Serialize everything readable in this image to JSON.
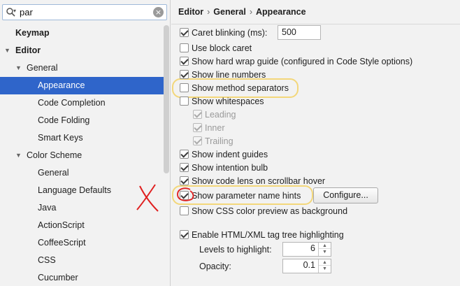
{
  "search": {
    "value": "par"
  },
  "tree": {
    "items": [
      {
        "label": "Keymap"
      },
      {
        "label": "Editor"
      },
      {
        "label": "General"
      },
      {
        "label": "Appearance"
      },
      {
        "label": "Code Completion"
      },
      {
        "label": "Code Folding"
      },
      {
        "label": "Smart Keys"
      },
      {
        "label": "Color Scheme"
      },
      {
        "label": "General"
      },
      {
        "label": "Language Defaults"
      },
      {
        "label": "Java"
      },
      {
        "label": "ActionScript"
      },
      {
        "label": "CoffeeScript"
      },
      {
        "label": "CSS"
      },
      {
        "label": "Cucumber"
      }
    ]
  },
  "breadcrumb": {
    "parts": [
      "Editor",
      "General",
      "Appearance"
    ]
  },
  "options": {
    "caret_blinking": {
      "label": "Caret blinking (ms):",
      "checked": true,
      "value": "500"
    },
    "block_caret": {
      "label": "Use block caret",
      "checked": false
    },
    "hard_wrap": {
      "label": "Show hard wrap guide (configured in Code Style options)",
      "checked": true
    },
    "line_numbers": {
      "label": "Show line numbers",
      "checked": true
    },
    "method_separators": {
      "label": "Show method separators",
      "checked": false
    },
    "whitespaces": {
      "label": "Show whitespaces",
      "checked": false
    },
    "leading": {
      "label": "Leading",
      "checked": true
    },
    "inner": {
      "label": "Inner",
      "checked": true
    },
    "trailing": {
      "label": "Trailing",
      "checked": true
    },
    "indent_guides": {
      "label": "Show indent guides",
      "checked": true
    },
    "intention_bulb": {
      "label": "Show intention bulb",
      "checked": true
    },
    "code_lens": {
      "label": "Show code lens on scrollbar hover",
      "checked": true
    },
    "param_hints": {
      "label": "Show parameter name hints",
      "checked": true
    },
    "configure_button": "Configure...",
    "css_color_preview": {
      "label": "Show CSS color preview as background",
      "checked": false
    },
    "tag_tree": {
      "label": "Enable HTML/XML tag tree highlighting",
      "checked": true
    },
    "levels": {
      "label": "Levels to highlight:",
      "value": "6"
    },
    "opacity": {
      "label": "Opacity:",
      "value": "0.1"
    }
  },
  "annotation_colors": {
    "highlight": "#f3d77a",
    "red_mark": "#e02020",
    "selection": "#2f65ca"
  }
}
